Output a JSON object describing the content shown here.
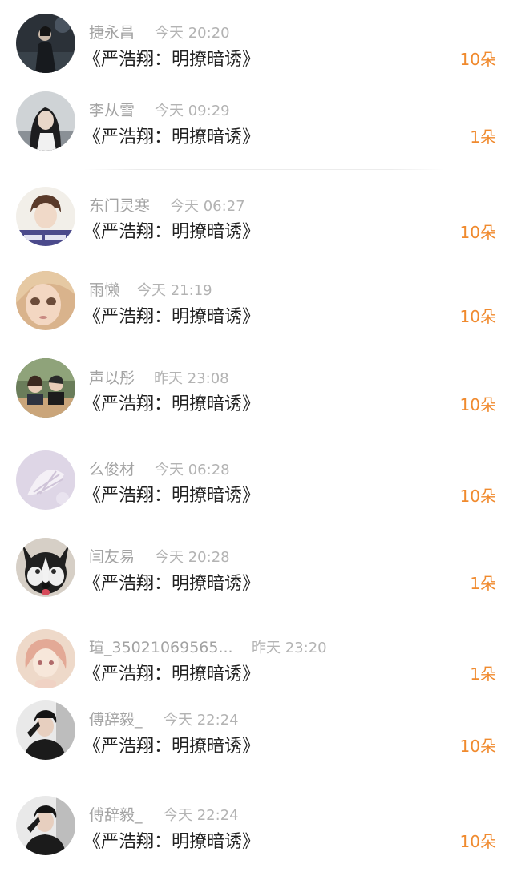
{
  "colors": {
    "count_accent": "#f08a2e",
    "name_gray": "#a3a3a3",
    "title_text": "#222222"
  },
  "gifts": [
    {
      "name": "捷永昌",
      "time": "今天 20:20",
      "title": "《严浩翔：明撩暗诱》",
      "count": "10朵",
      "avatar_icon": "dark-night-figure-avatar"
    },
    {
      "name": "李从雪",
      "time": "今天 09:29",
      "title": "《严浩翔：明撩暗诱》",
      "count": "1朵",
      "avatar_icon": "girl-long-hair-avatar"
    },
    {
      "name": "东门灵寒",
      "time": "今天 06:27",
      "title": "《严浩翔：明撩暗诱》",
      "count": "10朵",
      "avatar_icon": "young-man-selfie-avatar"
    },
    {
      "name": "雨懒",
      "time": "今天 21:19",
      "title": "《严浩翔：明撩暗诱》",
      "count": "10朵",
      "avatar_icon": "doll-face-avatar"
    },
    {
      "name": "声以彤",
      "time": "昨天 23:08",
      "title": "《严浩翔：明撩暗诱》",
      "count": "10朵",
      "avatar_icon": "couple-photo-avatar"
    },
    {
      "name": "么俊材",
      "time": "今天 06:28",
      "title": "《严浩翔：明撩暗诱》",
      "count": "10朵",
      "avatar_icon": "seashell-avatar"
    },
    {
      "name": "闫友易",
      "time": "今天 20:28",
      "title": "《严浩翔：明撩暗诱》",
      "count": "1朵",
      "avatar_icon": "husky-dog-avatar"
    },
    {
      "name": "瑄_35021069565...",
      "time": "昨天 23:20",
      "title": "《严浩翔：明撩暗诱》",
      "count": "1朵",
      "avatar_icon": "anime-girl-avatar"
    },
    {
      "name": "傅辞毅_",
      "time": "今天 22:24",
      "title": "《严浩翔：明撩暗诱》",
      "count": "10朵",
      "avatar_icon": "man-dark-jacket-avatar"
    },
    {
      "name": "傅辞毅_",
      "time": "今天 22:24",
      "title": "《严浩翔：明撩暗诱》",
      "count": "10朵",
      "avatar_icon": "man-dark-jacket-avatar"
    }
  ]
}
